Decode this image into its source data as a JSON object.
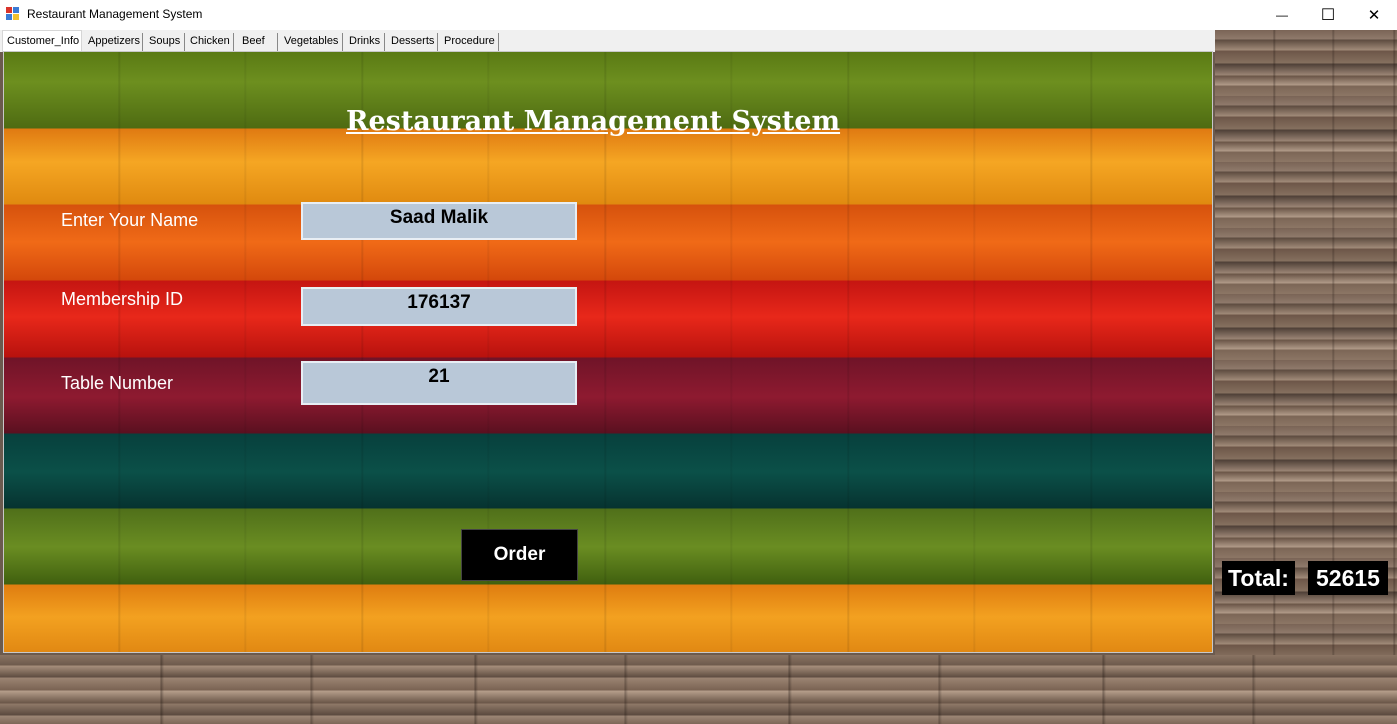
{
  "window": {
    "title": "Restaurant Management System",
    "minimize_glyph": "—",
    "maximize_glyph": "☐",
    "close_glyph": "✕"
  },
  "tabs": [
    {
      "label": "Customer_Info",
      "active": true
    },
    {
      "label": "Appetizers"
    },
    {
      "label": "Soups"
    },
    {
      "label": "Chicken"
    },
    {
      "label": "Beef"
    },
    {
      "label": "Vegetables"
    },
    {
      "label": "Drinks"
    },
    {
      "label": "Desserts"
    },
    {
      "label": "Procedure"
    }
  ],
  "form": {
    "heading": "Restaurant  Management System",
    "name_label": "Enter Your Name",
    "name_value": "Saad Malik",
    "membership_label": "Membership ID",
    "membership_value": "176137",
    "table_label": "Table Number",
    "table_value": "21",
    "order_button": "Order"
  },
  "total": {
    "label": "Total:",
    "value": "52615"
  }
}
